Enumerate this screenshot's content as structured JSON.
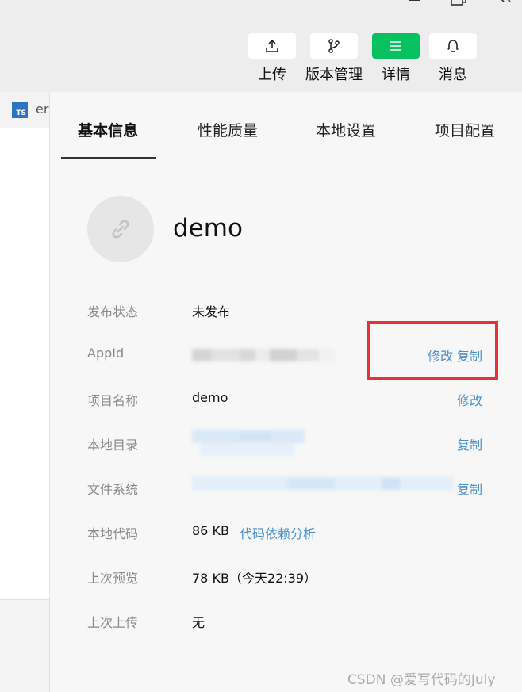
{
  "toolbar": {
    "buttons": [
      {
        "label": "上传",
        "icon": "upload-icon",
        "active": false
      },
      {
        "label": "版本管理",
        "icon": "branch-icon",
        "active": false
      },
      {
        "label": "详情",
        "icon": "menu-icon",
        "active": true
      },
      {
        "label": "消息",
        "icon": "bell-icon",
        "active": false
      }
    ]
  },
  "editor": {
    "file_badge": "TS",
    "file_name_fragment": "er"
  },
  "tabs": [
    {
      "label": "基本信息",
      "active": true
    },
    {
      "label": "性能质量",
      "active": false
    },
    {
      "label": "本地设置",
      "active": false
    },
    {
      "label": "项目配置",
      "active": false
    }
  ],
  "project": {
    "name": "demo",
    "avatar_icon": "link-icon"
  },
  "info": {
    "publish_status": {
      "label": "发布状态",
      "value": "未发布"
    },
    "appid": {
      "label": "AppId",
      "edit": "修改",
      "copy": "复制"
    },
    "project_name": {
      "label": "项目名称",
      "value": "demo",
      "edit": "修改"
    },
    "local_dir": {
      "label": "本地目录",
      "copy": "复制"
    },
    "file_system": {
      "label": "文件系统",
      "copy": "复制"
    },
    "local_code": {
      "label": "本地代码",
      "value": "86 KB",
      "link": "代码依赖分析"
    },
    "last_preview": {
      "label": "上次预览",
      "value": "78 KB（今天22:39）"
    },
    "last_upload": {
      "label": "上次上传",
      "value": "无"
    }
  },
  "watermark": "CSDN @爱写代码的July",
  "colors": {
    "accent_green": "#07c160",
    "link_blue": "#4a90c9",
    "highlight_red": "#e8323a"
  }
}
